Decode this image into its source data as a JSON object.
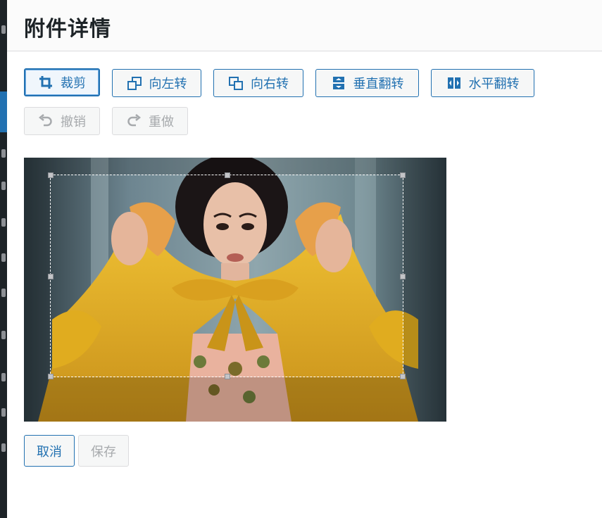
{
  "header": {
    "title": "附件详情"
  },
  "toolbar": {
    "crop_label": "裁剪",
    "rotate_left_label": "向左转",
    "rotate_right_label": "向右转",
    "flip_vertical_label": "垂直翻转",
    "flip_horizontal_label": "水平翻转",
    "undo_label": "撤销",
    "redo_label": "重做"
  },
  "footer": {
    "cancel_label": "取消",
    "save_label": "保存"
  },
  "colors": {
    "accent": "#2271b1",
    "disabled": "#a7aaad",
    "sidebar": "#1d2327",
    "coat": "#e0ac1f"
  },
  "icons": [
    "crop-icon",
    "rotate-left-icon",
    "rotate-right-icon",
    "flip-vertical-icon",
    "flip-horizontal-icon",
    "undo-icon",
    "redo-icon"
  ]
}
